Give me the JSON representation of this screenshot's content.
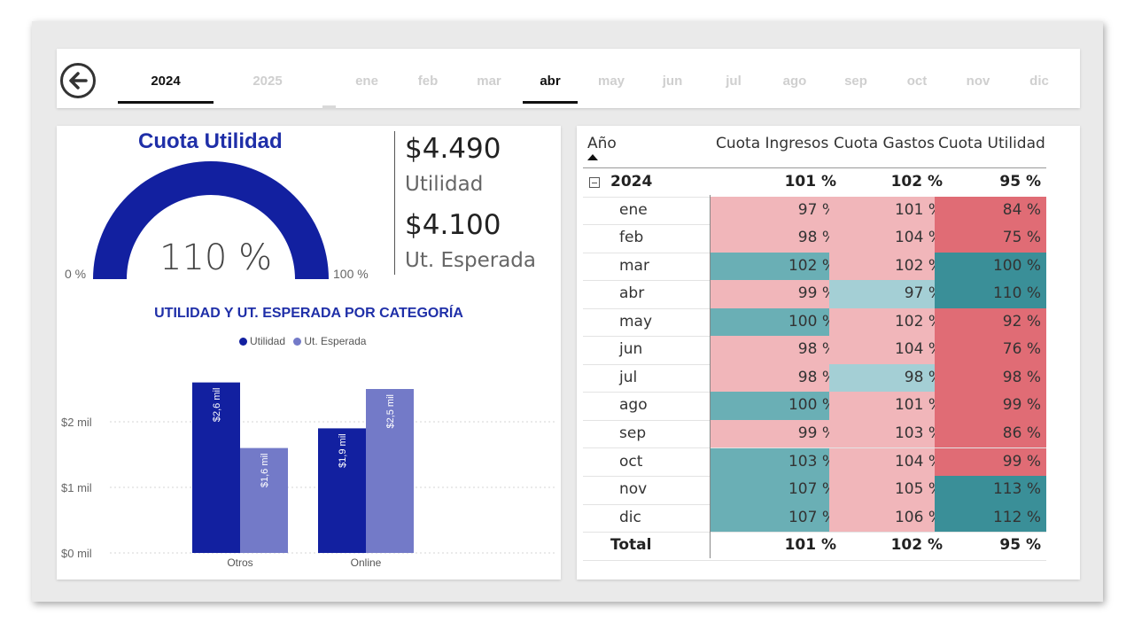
{
  "nav": {
    "years": [
      {
        "label": "2024",
        "active": true
      },
      {
        "label": "2025",
        "active": false
      }
    ],
    "months": [
      {
        "label": "ene",
        "active": false
      },
      {
        "label": "feb",
        "active": false
      },
      {
        "label": "mar",
        "active": false
      },
      {
        "label": "abr",
        "active": true
      },
      {
        "label": "may",
        "active": false
      },
      {
        "label": "jun",
        "active": false
      },
      {
        "label": "jul",
        "active": false
      },
      {
        "label": "ago",
        "active": false
      },
      {
        "label": "sep",
        "active": false
      },
      {
        "label": "oct",
        "active": false
      },
      {
        "label": "nov",
        "active": false
      },
      {
        "label": "dic",
        "active": false
      }
    ],
    "back_icon": "arrow-left-circle-icon"
  },
  "gauge": {
    "title": "Cuota Utilidad",
    "value_label": "110 %",
    "value": 1.1,
    "min_label": "0 %",
    "max_label": "100 %",
    "color": "#1220a0"
  },
  "kpis": {
    "utilidad_value": "$4.490",
    "utilidad_label": "Utilidad",
    "esperada_value": "$4.100",
    "esperada_label": "Ut. Esperada"
  },
  "chart_data": {
    "type": "bar",
    "title": "UTILIDAD Y UT. ESPERADA POR CATEGORÍA",
    "categories": [
      "Otros",
      "Online"
    ],
    "series": [
      {
        "name": "Utilidad",
        "values": [
          2.6,
          1.9
        ],
        "labels": [
          "$2,6 mil",
          "$1,9 mil"
        ],
        "color": "#1220a0"
      },
      {
        "name": "Ut. Esperada",
        "values": [
          1.6,
          2.5
        ],
        "labels": [
          "$1,6 mil",
          "$2,5 mil"
        ],
        "color": "#737ac8"
      }
    ],
    "y_ticks": [
      {
        "value": 0,
        "label": "$0 mil"
      },
      {
        "value": 1,
        "label": "$1 mil"
      },
      {
        "value": 2,
        "label": "$2 mil"
      }
    ],
    "ylim": [
      0,
      2.6
    ],
    "grid": true,
    "legend_position": "top-center"
  },
  "table": {
    "headers": [
      "Año",
      "Cuota Ingresos",
      "Cuota Gastos",
      "Cuota Utilidad"
    ],
    "group": {
      "label": "2024",
      "values": [
        "101 %",
        "102 %",
        "95 %"
      ]
    },
    "rows": [
      {
        "label": "ene",
        "values": [
          "97 %",
          "101 %",
          "84 %"
        ],
        "colors": [
          "#f1b6ba",
          "#f1b6ba",
          "#e06c75"
        ]
      },
      {
        "label": "feb",
        "values": [
          "98 %",
          "104 %",
          "75 %"
        ],
        "colors": [
          "#f1b6ba",
          "#f1b6ba",
          "#e06c75"
        ]
      },
      {
        "label": "mar",
        "values": [
          "102 %",
          "102 %",
          "100 %"
        ],
        "colors": [
          "#6aafb5",
          "#f1b6ba",
          "#3a8f98"
        ]
      },
      {
        "label": "abr",
        "values": [
          "99 %",
          "97 %",
          "110 %"
        ],
        "colors": [
          "#f1b6ba",
          "#a4cfd5",
          "#3a8f98"
        ]
      },
      {
        "label": "may",
        "values": [
          "100 %",
          "102 %",
          "92 %"
        ],
        "colors": [
          "#6aafb5",
          "#f1b6ba",
          "#e06c75"
        ]
      },
      {
        "label": "jun",
        "values": [
          "98 %",
          "104 %",
          "76 %"
        ],
        "colors": [
          "#f1b6ba",
          "#f1b6ba",
          "#e06c75"
        ]
      },
      {
        "label": "jul",
        "values": [
          "98 %",
          "98 %",
          "98 %"
        ],
        "colors": [
          "#f1b6ba",
          "#a4cfd5",
          "#e06c75"
        ]
      },
      {
        "label": "ago",
        "values": [
          "100 %",
          "101 %",
          "99 %"
        ],
        "colors": [
          "#6aafb5",
          "#f1b6ba",
          "#e06c75"
        ]
      },
      {
        "label": "sep",
        "values": [
          "99 %",
          "103 %",
          "86 %"
        ],
        "colors": [
          "#f1b6ba",
          "#f1b6ba",
          "#e06c75"
        ]
      },
      {
        "label": "oct",
        "values": [
          "103 %",
          "104 %",
          "99 %"
        ],
        "colors": [
          "#6aafb5",
          "#f1b6ba",
          "#e06c75"
        ]
      },
      {
        "label": "nov",
        "values": [
          "107 %",
          "105 %",
          "113 %"
        ],
        "colors": [
          "#6aafb5",
          "#f1b6ba",
          "#3a8f98"
        ]
      },
      {
        "label": "dic",
        "values": [
          "107 %",
          "106 %",
          "112 %"
        ],
        "colors": [
          "#6aafb5",
          "#f1b6ba",
          "#3a8f98"
        ]
      }
    ],
    "total": {
      "label": "Total",
      "values": [
        "101 %",
        "102 %",
        "95 %"
      ]
    }
  }
}
